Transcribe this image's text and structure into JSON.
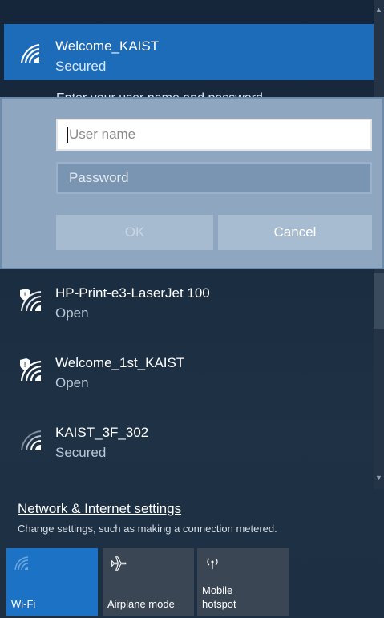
{
  "selected_network": {
    "name": "Welcome_KAIST",
    "status": "Secured",
    "prompt": "Enter your user name and password",
    "username_placeholder": "User name",
    "password_placeholder": "Password",
    "ok_label": "OK",
    "cancel_label": "Cancel"
  },
  "networks": [
    {
      "name": "HP-Print-e3-LaserJet 100",
      "status": "Open",
      "icon": "wifi-shield-icon"
    },
    {
      "name": "Welcome_1st_KAIST",
      "status": "Open",
      "icon": "wifi-shield-icon"
    },
    {
      "name": "KAIST_3F_302",
      "status": "Secured",
      "icon": "wifi-icon"
    }
  ],
  "footer": {
    "settings_link": "Network & Internet settings",
    "settings_desc": "Change settings, such as making a connection metered."
  },
  "quick_actions": {
    "wifi": "Wi-Fi",
    "airplane": "Airplane mode",
    "hotspot_line1": "Mobile",
    "hotspot_line2": "hotspot"
  },
  "colors": {
    "accent": "#1c6cb9",
    "tile_active": "#1c72c4",
    "tile_inactive": "#3a4654"
  }
}
